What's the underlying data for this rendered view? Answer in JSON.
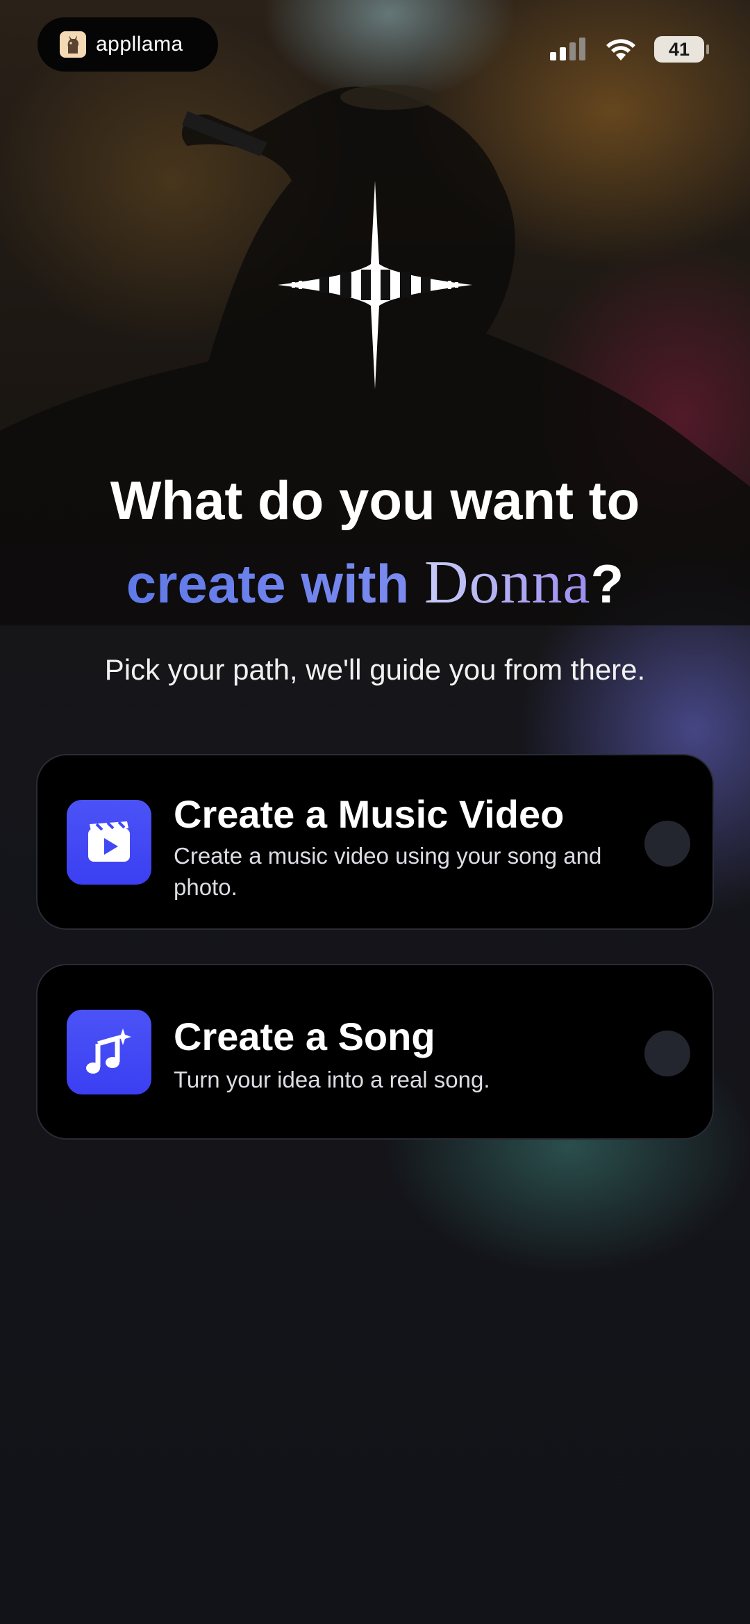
{
  "status_bar": {
    "app_pill": {
      "label": "appllama",
      "icon": "llama-icon"
    },
    "signal_icon": "cellular-signal-icon",
    "wifi_icon": "wifi-icon",
    "battery_level": "41"
  },
  "header": {
    "logo_icon": "donna-waveform-logo-icon",
    "line1": "What do you want to",
    "line2_prefix": "create with ",
    "line2_brand": "Donna",
    "line2_suffix": "?",
    "subtitle": "Pick your path, we'll guide you from there."
  },
  "options": [
    {
      "title": "Create a Music Video",
      "description": "Create a music video using your song and photo.",
      "icon": "video-clapper-icon",
      "selected": false
    },
    {
      "title": "Create a Song",
      "description": "Turn your idea into a real song.",
      "icon": "music-note-sparkle-icon",
      "selected": false
    }
  ],
  "colors": {
    "accent": "#4049f4",
    "card_bg": "#000000",
    "radio_bg": "#24262f",
    "headline_gradient_start": "#5f79e8",
    "brand_gradient_end": "#9a8cf0"
  }
}
